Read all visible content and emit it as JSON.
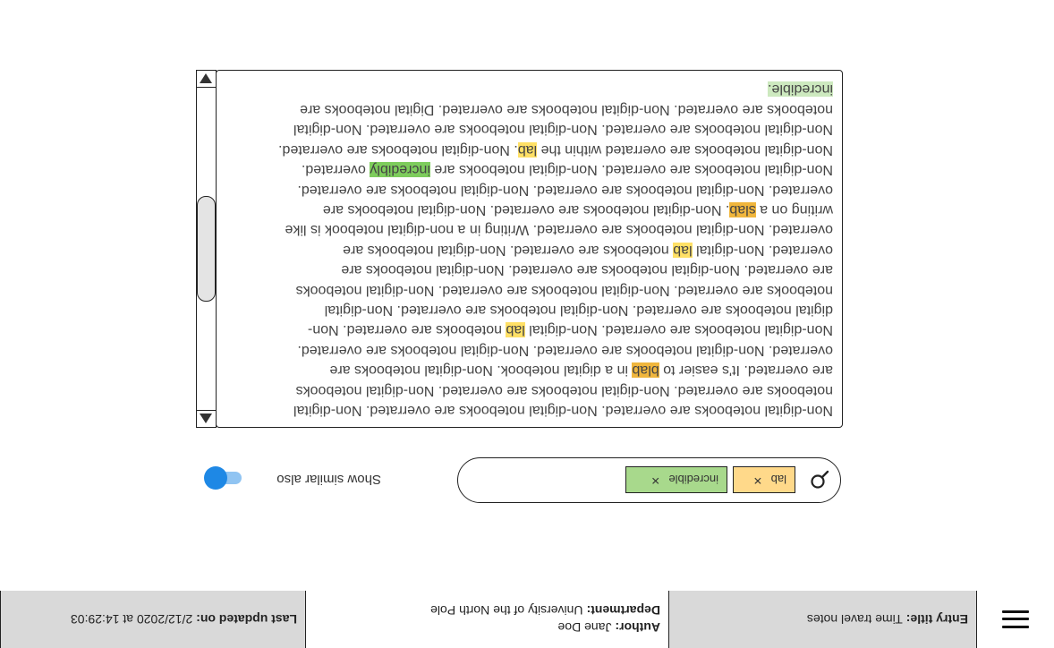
{
  "header": {
    "entry_title_label": "Entry title:",
    "entry_title_value": "Time travel notes",
    "author_label": "Author:",
    "author_value": "Jane Doe",
    "department_label": "Department:",
    "department_value": "University of the North Pole",
    "updated_label": "Last updated on:",
    "updated_value": "2/12/2020 at 14:29:03"
  },
  "search": {
    "tags": [
      {
        "label": "lab",
        "remove": "×"
      },
      {
        "label": "incredible",
        "remove": "×"
      }
    ]
  },
  "toggle": {
    "label": "Show similar also",
    "state": "on"
  },
  "document": {
    "lines": [
      [
        {
          "t": "Non-digital notebooks are overrated. Non-digital notebooks are overrated. Non-digital"
        }
      ],
      [
        {
          "t": "notebooks are overrated. Non-digital notebooks are overrated. Non-digital notebooks"
        }
      ],
      [
        {
          "t": "are overrated. It's easier to "
        },
        {
          "t": "blab",
          "h": "slab"
        },
        {
          "t": " in a digital notebook. Non-digital notebooks are"
        }
      ],
      [
        {
          "t": "overrated. Non-digital notebooks are overrated. Non-digital notebooks are overrated."
        }
      ],
      [
        {
          "t": "Non-digital notebooks are overrated. Non-digital "
        },
        {
          "t": "lab",
          "h": "lab"
        },
        {
          "t": " notebooks are overrated. Non-"
        }
      ],
      [
        {
          "t": "digital notebooks are overrated. Non-digital notebooks are overrated. Non-digital"
        }
      ],
      [
        {
          "t": "notebooks are overrated. Non-digital notebooks are overrated. Non-digital notebooks"
        }
      ],
      [
        {
          "t": "are overrated. Non-digital notebooks are overrated. Non-digital notebooks are"
        }
      ],
      [
        {
          "t": "overrated. Non-digital "
        },
        {
          "t": "lab",
          "h": "lab"
        },
        {
          "t": " notebooks are overrated. Non-digital notebooks are"
        }
      ],
      [
        {
          "t": "overrated. Non-digital notebooks are overrated. Writing in a non-digital notebook is like"
        }
      ],
      [
        {
          "t": "writing on a "
        },
        {
          "t": "slab",
          "h": "slab"
        },
        {
          "t": ". Non-digital notebooks are overrated. Non-digital notebooks are"
        }
      ],
      [
        {
          "t": "overrated. Non-digital notebooks are overrated. Non-digital notebooks are overrated."
        }
      ],
      [
        {
          "t": "Non-digital notebooks are overrated. Non-digital notebooks are "
        },
        {
          "t": "incredibly",
          "h": "incredibly"
        },
        {
          "t": " overrated."
        }
      ],
      [
        {
          "t": "Non-digital notebooks are overrated within the "
        },
        {
          "t": "lab",
          "h": "lab"
        },
        {
          "t": ". Non-digital notebooks are overrated."
        }
      ],
      [
        {
          "t": "Non-digital notebooks are overrated. Non-digital notebooks are overrated. Non-digital"
        }
      ],
      [
        {
          "t": "notebooks are overrated. Non-digital notebooks are overrated. Digital notebooks are"
        }
      ],
      [
        {
          "t": "incredible.",
          "h": "incredible"
        }
      ]
    ]
  },
  "colors": {
    "highlight_lab": "#ffe066",
    "highlight_similar": "#f0b63d",
    "highlight_incredibly": "#7dcc5c",
    "highlight_incredible": "#cde9bf",
    "tag_lab_bg": "#ffd98a",
    "tag_incredible_bg": "#a8d98c",
    "toggle_accent": "#1e88e5",
    "header_gray": "#d9d9d9"
  },
  "icons": {
    "menu": "hamburger-icon",
    "search": "search-icon",
    "remove": "close-icon",
    "scroll_up": "triangle-up-icon",
    "scroll_down": "triangle-down-icon"
  }
}
